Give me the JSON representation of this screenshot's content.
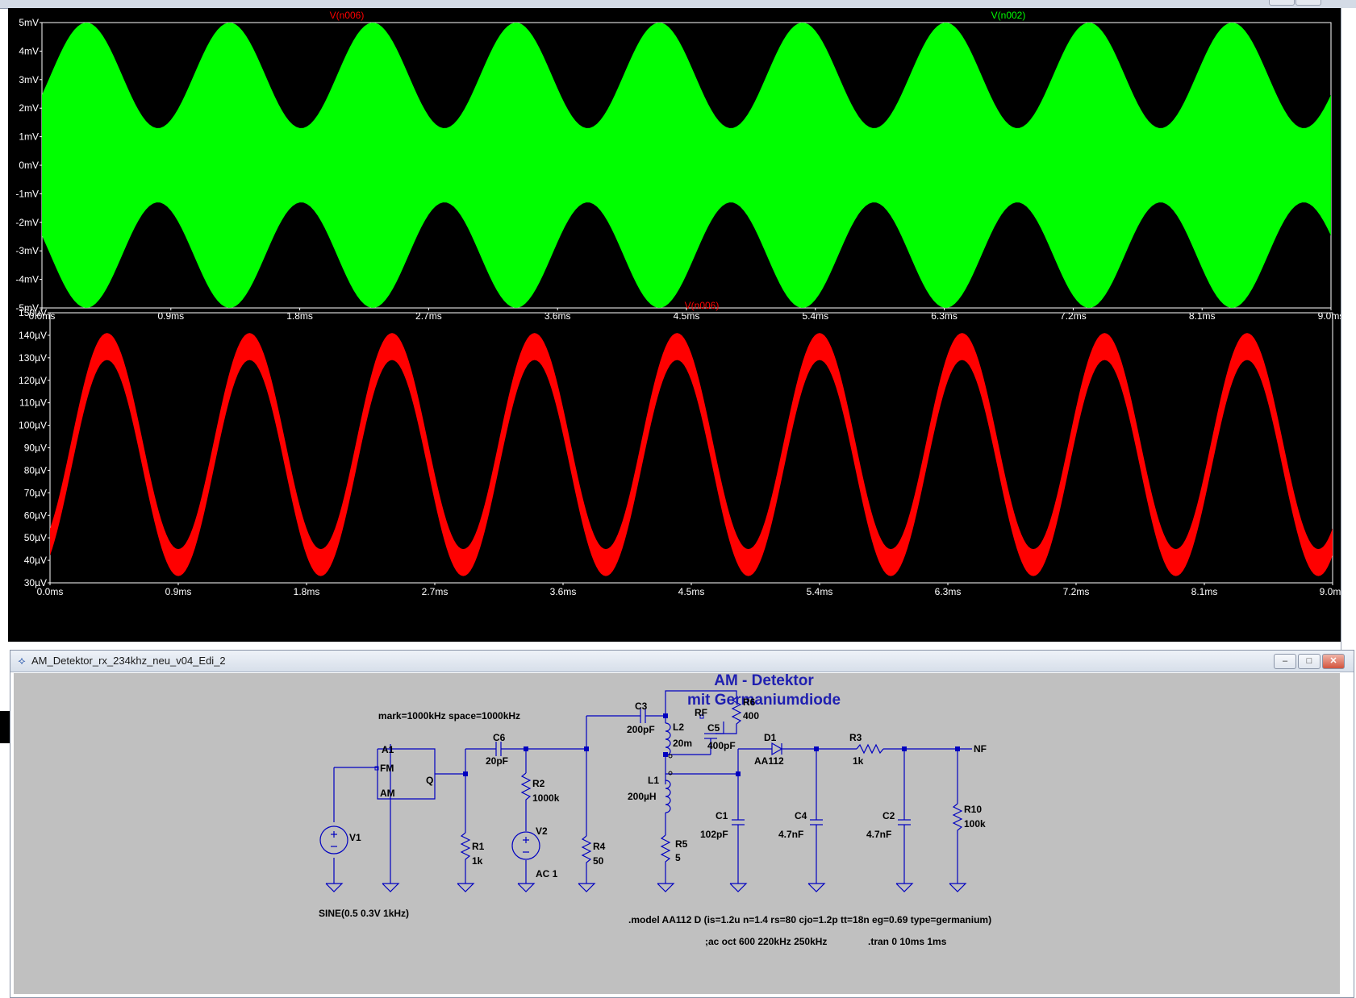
{
  "colors": {
    "plot_background": "#000000",
    "axis_text": "#ffffff",
    "trace_top": "#00ff00",
    "trace_bottom": "#ff0000",
    "title_red": "#ff0000",
    "title_green": "#00ff00",
    "schematic_bg": "#c0c0c0",
    "wire": "#0000c0",
    "comp_text": "#000000",
    "title_text": "#1f1fb0"
  },
  "plot_top": {
    "trace_labels": [
      "V(n006)",
      "V(n002)"
    ],
    "y_ticks": [
      "5mV",
      "4mV",
      "3mV",
      "2mV",
      "1mV",
      "0mV",
      "-1mV",
      "-2mV",
      "-3mV",
      "-4mV",
      "-5mV"
    ],
    "x_ticks": [
      "0.0ms",
      "0.9ms",
      "1.8ms",
      "2.7ms",
      "3.6ms",
      "4.5ms",
      "5.4ms",
      "6.3ms",
      "7.2ms",
      "8.1ms",
      "9.0ms"
    ]
  },
  "plot_bottom": {
    "trace_label": "V(n006)",
    "y_ticks": [
      "150µV",
      "140µV",
      "130µV",
      "120µV",
      "110µV",
      "100µV",
      "90µV",
      "80µV",
      "70µV",
      "60µV",
      "50µV",
      "40µV",
      "30µV"
    ],
    "x_ticks": [
      "0.0ms",
      "0.9ms",
      "1.8ms",
      "2.7ms",
      "3.6ms",
      "4.5ms",
      "5.4ms",
      "6.3ms",
      "7.2ms",
      "8.1ms",
      "9.0ms"
    ]
  },
  "chart_data": [
    {
      "type": "line",
      "trace": "V(n002)",
      "signal": "AM carrier envelope",
      "xlim_ms": [
        0,
        9
      ],
      "ylim_mV": [
        -5,
        5
      ],
      "envelope_peak_mV": 5,
      "envelope_trough_mV": 1.3,
      "modulation_frequency_kHz": 1,
      "envelope_max_at_ms": [
        0.31,
        1.31,
        2.31,
        3.31,
        4.31,
        5.31,
        6.31,
        7.31,
        8.31
      ]
    },
    {
      "type": "line",
      "trace": "V(n006)",
      "signal": "demodulated audio",
      "xlim_ms": [
        0,
        9
      ],
      "ylim_uV": [
        30,
        150
      ],
      "max_uV": 141,
      "min_uV": 33,
      "ripple_band_uV": 12,
      "peaks_at_ms": [
        0.4,
        1.4,
        2.4,
        3.4,
        4.4,
        5.4,
        6.4,
        7.4,
        8.4
      ]
    }
  ],
  "schematic_window": {
    "title": "AM_Detektor_rx_234khz_neu_v04_Edi_2",
    "buttons": {
      "minimize": "–",
      "restore": "□",
      "close": "✕"
    },
    "heading_line1": "AM - Detektor",
    "heading_line2": "mit Germaniumdiode",
    "mark_space": "mark=1000kHz space=1000kHz",
    "modulator": {
      "name": "A1",
      "fm": "FM",
      "am": "AM",
      "q": "Q"
    },
    "v1": {
      "name": "V1",
      "value": "SINE(0.5 0.3V 1kHz)"
    },
    "c6": {
      "name": "C6",
      "value": "20pF"
    },
    "r1": {
      "name": "R1",
      "value": "1k"
    },
    "r2": {
      "name": "R2",
      "value": "1000k"
    },
    "v2": {
      "name": "V2",
      "value": "AC 1"
    },
    "r4": {
      "name": "R4",
      "value": "50"
    },
    "c3": {
      "name": "C3",
      "value": "200pF"
    },
    "l2": {
      "name": "L2",
      "value": "20m"
    },
    "rf": "RF",
    "r6": {
      "name": "R6",
      "value": "400"
    },
    "c5": {
      "name": "C5",
      "value": "400pF"
    },
    "l1": {
      "name": "L1",
      "value": "200µH"
    },
    "r5": {
      "name": "R5",
      "value": "5"
    },
    "c1": {
      "name": "C1",
      "value": "102pF"
    },
    "d1": {
      "name": "D1",
      "value": "AA112"
    },
    "c4": {
      "name": "C4",
      "value": "4.7nF"
    },
    "r3": {
      "name": "R3",
      "value": "1k"
    },
    "c2": {
      "name": "C2",
      "value": "4.7nF"
    },
    "r10": {
      "name": "R10",
      "value": "100k"
    },
    "nf": "NF",
    "model_line": ".model AA112 D (is=1.2u n=1.4 rs=80 cjo=1.2p tt=18n eg=0.69 type=germanium)",
    "ac_line": ";ac oct 600 220kHz 250kHz",
    "tran_line": ".tran 0 10ms 1ms"
  }
}
